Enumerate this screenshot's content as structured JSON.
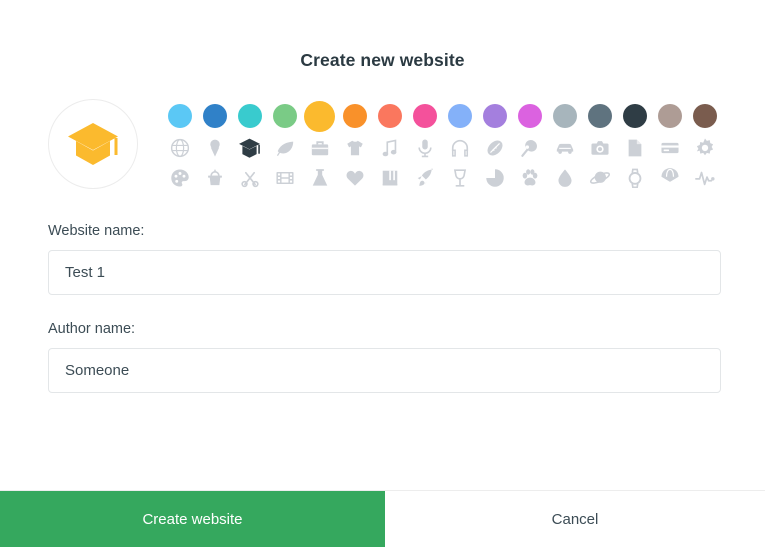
{
  "dialog": {
    "title": "Create new website"
  },
  "preview": {
    "name": "website-icon-preview",
    "icon": "box-icon",
    "color": "#FBBA2E",
    "circle_border": "#ECECEC"
  },
  "colors": {
    "label": "color-swatches",
    "selected_index": 4,
    "items": [
      {
        "name": "light-blue",
        "hex": "#5BC8F5"
      },
      {
        "name": "blue",
        "hex": "#3081C8"
      },
      {
        "name": "teal",
        "hex": "#39CBCE"
      },
      {
        "name": "green",
        "hex": "#7ACB86"
      },
      {
        "name": "amber",
        "hex": "#FBBA2E"
      },
      {
        "name": "orange",
        "hex": "#F9912A"
      },
      {
        "name": "coral",
        "hex": "#FA775E"
      },
      {
        "name": "pink",
        "hex": "#F4519B"
      },
      {
        "name": "periwinkle",
        "hex": "#84B1F9"
      },
      {
        "name": "purple",
        "hex": "#A47FDE"
      },
      {
        "name": "magenta",
        "hex": "#DB62E0"
      },
      {
        "name": "slate-light",
        "hex": "#A7B5BC"
      },
      {
        "name": "slate",
        "hex": "#5F737F"
      },
      {
        "name": "dark-navy",
        "hex": "#2F3D45"
      },
      {
        "name": "taupe",
        "hex": "#AE9C95"
      },
      {
        "name": "brown",
        "hex": "#7A5C4E"
      }
    ]
  },
  "icons": {
    "label": "icon-picker",
    "selected_index": 2,
    "items": [
      {
        "name": "globe-icon"
      },
      {
        "name": "ice-cream-icon"
      },
      {
        "name": "box-icon"
      },
      {
        "name": "leaf-icon"
      },
      {
        "name": "briefcase-icon"
      },
      {
        "name": "tshirt-icon"
      },
      {
        "name": "music-note-icon"
      },
      {
        "name": "microphone-icon"
      },
      {
        "name": "headphones-icon"
      },
      {
        "name": "football-icon"
      },
      {
        "name": "pingpong-paddle-icon"
      },
      {
        "name": "car-icon"
      },
      {
        "name": "camera-icon"
      },
      {
        "name": "file-icon"
      },
      {
        "name": "credit-card-icon"
      },
      {
        "name": "gear-icon"
      },
      {
        "name": "palette-icon"
      },
      {
        "name": "basket-icon"
      },
      {
        "name": "scissors-icon"
      },
      {
        "name": "film-icon"
      },
      {
        "name": "flask-icon"
      },
      {
        "name": "heart-icon"
      },
      {
        "name": "book-icon"
      },
      {
        "name": "rocket-icon"
      },
      {
        "name": "wine-glass-icon"
      },
      {
        "name": "pie-chart-icon"
      },
      {
        "name": "paw-icon"
      },
      {
        "name": "water-drop-icon"
      },
      {
        "name": "planet-icon"
      },
      {
        "name": "watch-icon"
      },
      {
        "name": "parachute-icon"
      },
      {
        "name": "heartbeat-icon"
      }
    ]
  },
  "form": {
    "website_name": {
      "label": "Website name:",
      "value": "Test 1",
      "placeholder": ""
    },
    "author_name": {
      "label": "Author name:",
      "value": "Someone",
      "placeholder": ""
    }
  },
  "footer": {
    "create_label": "Create website",
    "cancel_label": "Cancel",
    "create_color": "#35A85E"
  }
}
